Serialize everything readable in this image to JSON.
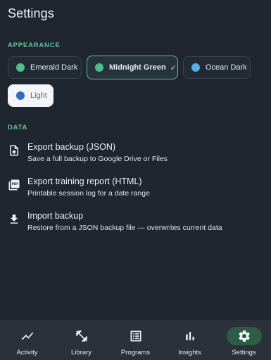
{
  "header": {
    "title": "Settings"
  },
  "appearance": {
    "section_label": "APPEARANCE",
    "themes": [
      {
        "label": "Emerald Dark",
        "color": "#4fbf86",
        "selected": false
      },
      {
        "label": "Midnight Green",
        "color": "#4fbf86",
        "selected": true,
        "check": "✓"
      },
      {
        "label": "Ocean Dark",
        "color": "#5aaee8",
        "selected": false
      },
      {
        "label": "Light",
        "color": "#2f6cc0",
        "selected": false
      }
    ]
  },
  "data": {
    "section_label": "DATA",
    "items": [
      {
        "icon": "upload-file-icon",
        "title": "Export backup (JSON)",
        "subtitle": "Save a full backup to Google Drive or Files"
      },
      {
        "icon": "pdf-icon",
        "title": "Export training report (HTML)",
        "subtitle": "Printable session log for a date range"
      },
      {
        "icon": "download-icon",
        "title": "Import backup",
        "subtitle": "Restore from a JSON backup file — overwrites current data"
      }
    ]
  },
  "nav": {
    "items": [
      {
        "icon": "activity-icon",
        "label": "Activity",
        "active": false
      },
      {
        "icon": "library-icon",
        "label": "Library",
        "active": false
      },
      {
        "icon": "programs-icon",
        "label": "Programs",
        "active": false
      },
      {
        "icon": "insights-icon",
        "label": "Insights",
        "active": false
      },
      {
        "icon": "settings-gear-icon",
        "label": "Settings",
        "active": true
      }
    ]
  },
  "colors": {
    "accent": "#63c29a",
    "background": "#1f2630",
    "nav_background": "#2a313b",
    "active_pill": "#2e5c45"
  }
}
